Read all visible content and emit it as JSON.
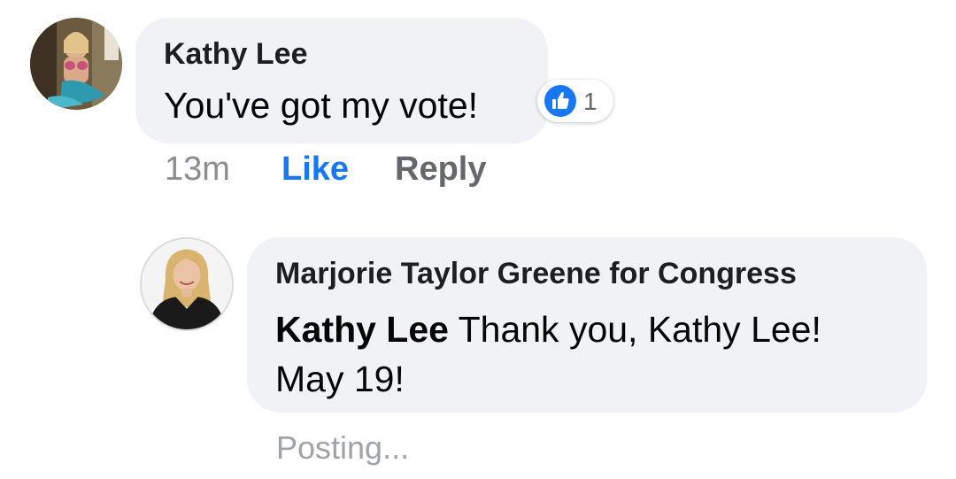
{
  "comment": {
    "author": "Kathy Lee",
    "text": "You've got my vote!",
    "reaction": {
      "icon": "thumbs-up-icon",
      "count": "1",
      "color": "#1877f2"
    },
    "timestamp": "13m",
    "actions": {
      "like": "Like",
      "reply": "Reply"
    }
  },
  "reply": {
    "author": "Marjorie Taylor Greene for Congress",
    "mention": "Kathy Lee",
    "text_line1": " Thank you, Kathy Lee!",
    "text_line2": "May 19!",
    "status": "Posting..."
  },
  "colors": {
    "bubble": "#f0f2f5",
    "link": "#1877f2",
    "secondary_text": "#65676b"
  }
}
